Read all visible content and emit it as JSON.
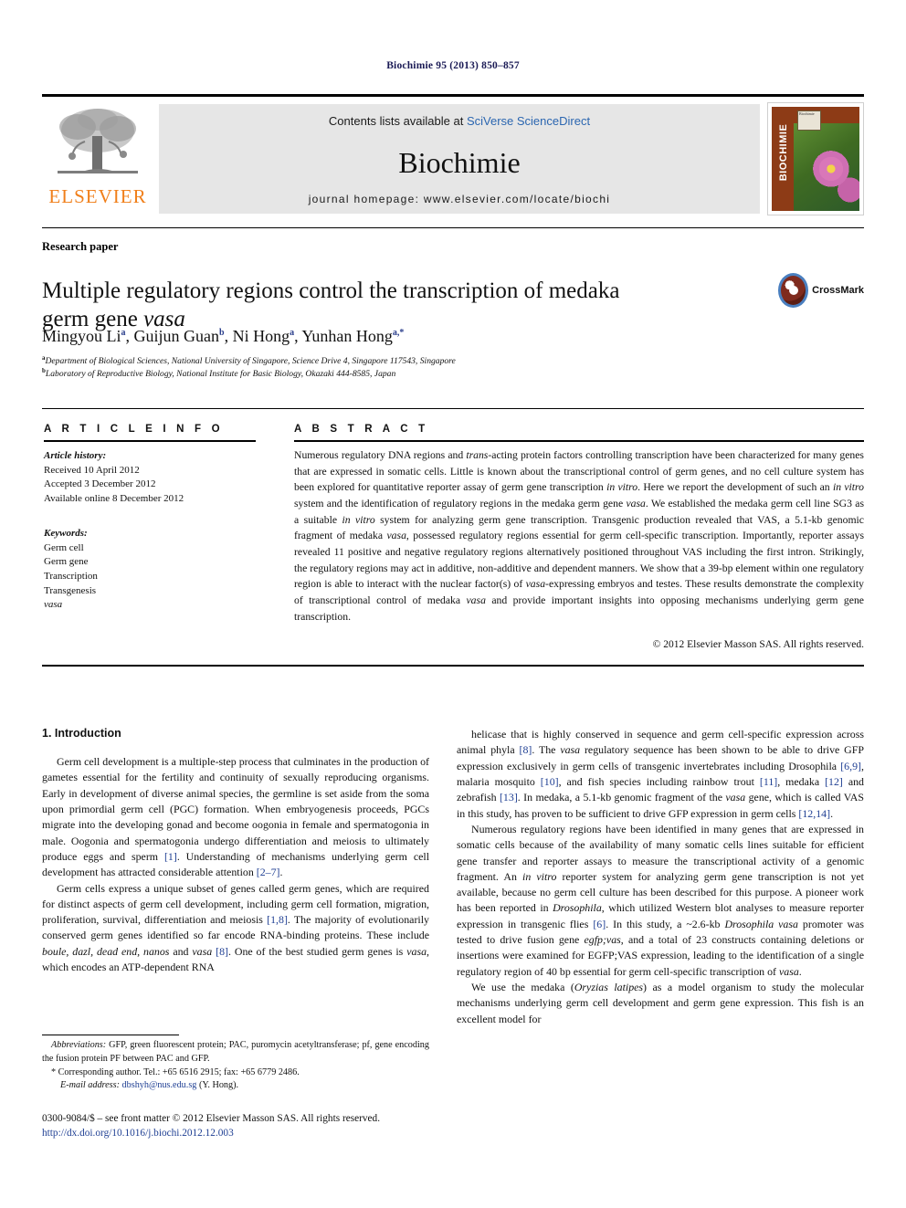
{
  "running_head": "Biochimie 95 (2013) 850–857",
  "masthead": {
    "publisher_name": "ELSEVIER",
    "publisher_logo_icon": "elsevier-tree-logo",
    "contents_prefix": "Contents lists available at ",
    "contents_link": "SciVerse ScienceDirect",
    "journal_title": "Biochimie",
    "homepage": "journal homepage: www.elsevier.com/locate/biochi",
    "cover_spine_title": "BIOCHIMIE",
    "cover_badge_text": "Biochimie"
  },
  "article": {
    "section_type": "Research paper",
    "title_line1": "Multiple regulatory regions control the transcription of medaka",
    "title_line2_plain": "germ gene ",
    "title_line2_italic": "vasa",
    "crossmark_label": "CrossMark",
    "crossmark_icon": "crossmark-badge-icon",
    "authors": [
      {
        "name": "Mingyou Li",
        "sup": "a",
        "sep": ", "
      },
      {
        "name": "Guijun Guan",
        "sup": "b",
        "sep": ", "
      },
      {
        "name": "Ni Hong",
        "sup": "a",
        "sep": ", "
      },
      {
        "name": "Yunhan Hong",
        "sup": "a,*",
        "sep": ""
      }
    ],
    "affiliations": [
      {
        "marker": "a",
        "text": "Department of Biological Sciences, National University of Singapore, Science Drive 4, Singapore 117543, Singapore"
      },
      {
        "marker": "b",
        "text": "Laboratory of Reproductive Biology, National Institute for Basic Biology, Okazaki 444-8585, Japan"
      }
    ]
  },
  "article_info": {
    "heading": "A R T I C L E   I N F O",
    "history_label": "Article history:",
    "history": [
      "Received 10 April 2012",
      "Accepted 3 December 2012",
      "Available online 8 December 2012"
    ],
    "keywords_label": "Keywords:",
    "keywords": [
      "Germ cell",
      "Germ gene",
      "Transcription",
      "Transgenesis"
    ],
    "keyword_italic": "vasa"
  },
  "abstract": {
    "heading": "A B S T R A C T",
    "text_parts": [
      {
        "t": "Numerous regulatory DNA regions and ",
        "i": false
      },
      {
        "t": "trans",
        "i": true
      },
      {
        "t": "-acting protein factors controlling transcription have been characterized for many genes that are expressed in somatic cells. Little is known about the transcriptional control of germ genes, and no cell culture system has been explored for quantitative reporter assay of germ gene transcription ",
        "i": false
      },
      {
        "t": "in vitro",
        "i": true
      },
      {
        "t": ". Here we report the development of such an ",
        "i": false
      },
      {
        "t": "in vitro",
        "i": true
      },
      {
        "t": " system and the identification of regulatory regions in the medaka germ gene ",
        "i": false
      },
      {
        "t": "vasa",
        "i": true
      },
      {
        "t": ". We established the medaka germ cell line SG3 as a suitable ",
        "i": false
      },
      {
        "t": "in vitro",
        "i": true
      },
      {
        "t": " system for analyzing germ gene transcription. Transgenic production revealed that VAS, a 5.1-kb genomic fragment of medaka ",
        "i": false
      },
      {
        "t": "vasa",
        "i": true
      },
      {
        "t": ", possessed regulatory regions essential for germ cell-specific transcription. Importantly, reporter assays revealed 11 positive and negative regulatory regions alternatively positioned throughout VAS including the first intron. Strikingly, the regulatory regions may act in additive, non-additive and dependent manners. We show that a 39-bp element within one regulatory region is able to interact with the nuclear factor(s) of ",
        "i": false
      },
      {
        "t": "vasa",
        "i": true
      },
      {
        "t": "-expressing embryos and testes. These results demonstrate the complexity of transcriptional control of medaka ",
        "i": false
      },
      {
        "t": "vasa",
        "i": true
      },
      {
        "t": " and provide important insights into opposing mechanisms underlying germ gene transcription.",
        "i": false
      }
    ],
    "copyright": "© 2012 Elsevier Masson SAS. All rights reserved."
  },
  "body": {
    "section_number_title": "1.  Introduction",
    "left_column": [
      [
        {
          "t": "Germ cell development is a multiple-step process that culminates in the production of gametes essential for the fertility and continuity of sexually reproducing organisms. Early in development of diverse animal species, the germline is set aside from the soma upon primordial germ cell (PGC) formation. When embryogenesis proceeds, PGCs migrate into the developing gonad and become oogonia in female and spermatogonia in male. Oogonia and spermatogonia undergo differentiation and meiosis to ultimately produce eggs and sperm ",
          "i": false
        },
        {
          "t": "[1]",
          "i": false,
          "r": true
        },
        {
          "t": ". Understanding of mechanisms underlying germ cell development has attracted considerable attention ",
          "i": false
        },
        {
          "t": "[2–7]",
          "i": false,
          "r": true
        },
        {
          "t": ".",
          "i": false
        }
      ],
      [
        {
          "t": "Germ cells express a unique subset of genes called germ genes, which are required for distinct aspects of germ cell development, including germ cell formation, migration, proliferation, survival, differentiation and meiosis ",
          "i": false
        },
        {
          "t": "[1,8]",
          "i": false,
          "r": true
        },
        {
          "t": ". The majority of evolutionarily conserved germ genes identified so far encode RNA-binding proteins. These include ",
          "i": false
        },
        {
          "t": "boule, dazl, dead end, nanos",
          "i": true
        },
        {
          "t": " and ",
          "i": false
        },
        {
          "t": "vasa",
          "i": true
        },
        {
          "t": " ",
          "i": false
        },
        {
          "t": "[8]",
          "i": false,
          "r": true
        },
        {
          "t": ". One of the best studied germ genes is ",
          "i": false
        },
        {
          "t": "vasa",
          "i": true
        },
        {
          "t": ", which encodes an ATP-dependent RNA",
          "i": false
        }
      ]
    ],
    "right_column": [
      [
        {
          "t": "helicase that is highly conserved in sequence and germ cell-specific expression across animal phyla ",
          "i": false
        },
        {
          "t": "[8]",
          "i": false,
          "r": true
        },
        {
          "t": ". The ",
          "i": false
        },
        {
          "t": "vasa",
          "i": true
        },
        {
          "t": " regulatory sequence has been shown to be able to drive GFP expression exclusively in germ cells of transgenic invertebrates including Drosophila ",
          "i": false
        },
        {
          "t": "[6,9]",
          "i": false,
          "r": true
        },
        {
          "t": ", malaria mosquito ",
          "i": false
        },
        {
          "t": "[10]",
          "i": false,
          "r": true
        },
        {
          "t": ", and fish species including rainbow trout ",
          "i": false
        },
        {
          "t": "[11]",
          "i": false,
          "r": true
        },
        {
          "t": ", medaka ",
          "i": false
        },
        {
          "t": "[12]",
          "i": false,
          "r": true
        },
        {
          "t": " and zebrafish ",
          "i": false
        },
        {
          "t": "[13]",
          "i": false,
          "r": true
        },
        {
          "t": ". In medaka, a 5.1-kb genomic fragment of the ",
          "i": false
        },
        {
          "t": "vasa",
          "i": true
        },
        {
          "t": " gene, which is called VAS in this study, has proven to be sufficient to drive GFP expression in germ cells ",
          "i": false
        },
        {
          "t": "[12,14]",
          "i": false,
          "r": true
        },
        {
          "t": ".",
          "i": false
        }
      ],
      [
        {
          "t": "Numerous regulatory regions have been identified in many genes that are expressed in somatic cells because of the availability of many somatic cells lines suitable for efficient gene transfer and reporter assays to measure the transcriptional activity of a genomic fragment. An ",
          "i": false
        },
        {
          "t": "in vitro",
          "i": true
        },
        {
          "t": " reporter system for analyzing germ gene transcription is not yet available, because no germ cell culture has been described for this purpose. A pioneer work has been reported in ",
          "i": false
        },
        {
          "t": "Drosophila",
          "i": true
        },
        {
          "t": ", which utilized Western blot analyses to measure reporter expression in transgenic flies ",
          "i": false
        },
        {
          "t": "[6]",
          "i": false,
          "r": true
        },
        {
          "t": ". In this study, a ~2.6-kb ",
          "i": false
        },
        {
          "t": "Drosophila vasa",
          "i": true
        },
        {
          "t": " promoter was tested to drive fusion gene ",
          "i": false
        },
        {
          "t": "egfp;vas",
          "i": true
        },
        {
          "t": ", and a total of 23 constructs containing deletions or insertions were examined for EGFP;VAS expression, leading to the identification of a single regulatory region of 40 bp essential for germ cell-specific transcription of ",
          "i": false
        },
        {
          "t": "vasa",
          "i": true
        },
        {
          "t": ".",
          "i": false
        }
      ],
      [
        {
          "t": "We use the medaka (",
          "i": false
        },
        {
          "t": "Oryzias latipes",
          "i": true
        },
        {
          "t": ") as a model organism to study the molecular mechanisms underlying germ cell development and germ gene expression. This fish is an excellent model for",
          "i": false
        }
      ]
    ]
  },
  "footnotes": {
    "abbreviations_label": "Abbreviations:",
    "abbreviations_text": " GFP, green fluorescent protein; PAC, puromycin acetyltransferase; pf, gene encoding the fusion protein PF between PAC and GFP.",
    "corresponding": "* Corresponding author. Tel.: +65 6516 2915; fax: +65 6779 2486.",
    "email_label": "E-mail address:",
    "email_link": "dbshyh@nus.edu.sg",
    "email_suffix": " (Y. Hong)."
  },
  "imprint": {
    "line1": "0300-9084/$ – see front matter © 2012 Elsevier Masson SAS. All rights reserved.",
    "doi": "http://dx.doi.org/10.1016/j.biochi.2012.12.003"
  }
}
